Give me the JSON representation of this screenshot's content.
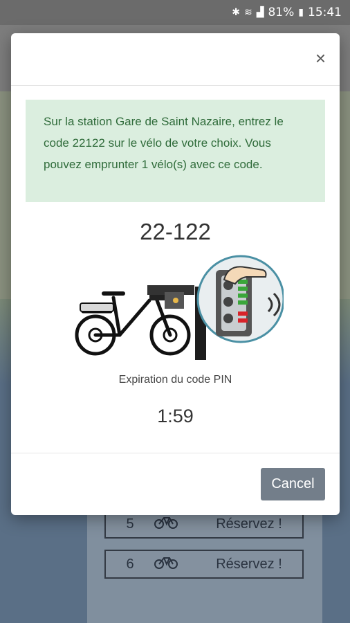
{
  "status_bar": {
    "battery_percent": "81%",
    "time": "15:41",
    "icons": [
      "bluetooth-icon",
      "wifi-icon",
      "signal-icon",
      "battery-icon"
    ]
  },
  "background": {
    "rows": [
      {
        "number": "5",
        "reserve_label": "Réservez !"
      },
      {
        "number": "6",
        "reserve_label": "Réservez !"
      }
    ]
  },
  "modal": {
    "close_symbol": "×",
    "message": "Sur la station Gare de Saint Nazaire, entrez le code 22122 sur le vélo de votre choix. Vous pouvez emprunter 1 vélo(s) avec ce code.",
    "pin_code": "22-122",
    "expiration_label": "Expiration du code PIN",
    "timer": "1:59",
    "cancel_label": "Cancel"
  },
  "colors": {
    "alert_bg": "#dbeedf",
    "alert_text": "#2f6b3a",
    "cancel_bg": "#737e8a",
    "keypad_green": "#3aa63a",
    "keypad_red": "#d8232a"
  }
}
